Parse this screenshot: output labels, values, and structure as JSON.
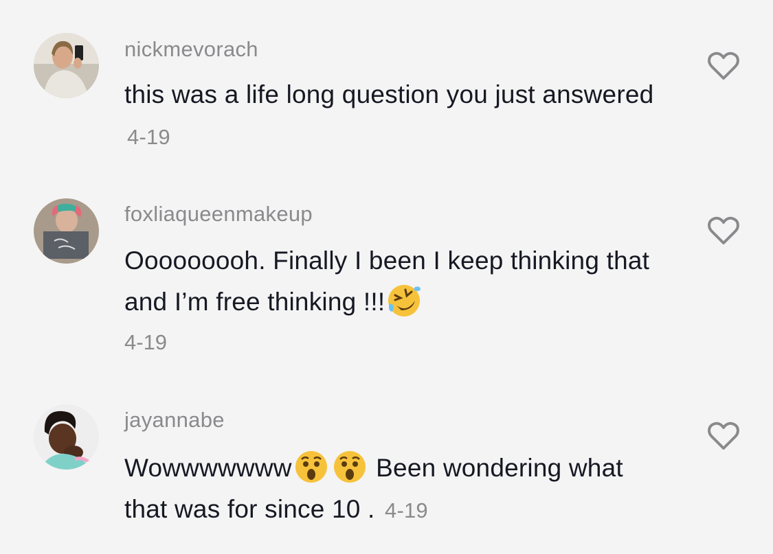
{
  "comments": [
    {
      "username": "nickmevorach",
      "text": "this was a life long question you just answered",
      "date": "4-19",
      "avatar_icon": "user-avatar-photo",
      "like_icon": "heart-outline-icon"
    },
    {
      "username": "foxliaqueenmakeup",
      "text_before_emoji": "Ooooooooh. Finally I been I keep thinking that and I’m free thinking !!!",
      "emoji": "rolling-on-floor-laughing-emoji",
      "date": "4-19",
      "avatar_icon": "user-avatar-photo",
      "like_icon": "heart-outline-icon"
    },
    {
      "username": "jayannabe",
      "text_start": "Wowwwwwww",
      "emoji": "astonished-face-emoji",
      "text_end": " Been wondering what that was for since 10 .",
      "date": "4-19",
      "avatar_icon": "user-avatar-photo",
      "like_icon": "heart-outline-icon"
    }
  ],
  "colors": {
    "background": "#f4f4f4",
    "username": "#8a8a8d",
    "text": "#161823",
    "heart": "#8a8a8d"
  }
}
